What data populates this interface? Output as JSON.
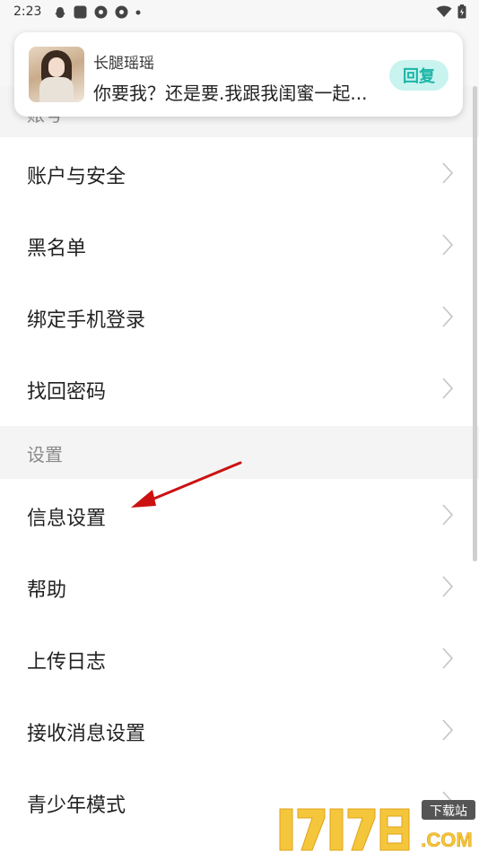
{
  "status_bar": {
    "time": "2:23"
  },
  "notification": {
    "sender": "长腿瑶瑶",
    "message": "你要我？还是要.我跟我闺蜜一起...",
    "reply_label": "回复"
  },
  "sections": [
    {
      "header": "账号",
      "items": [
        "账户与安全",
        "黑名单",
        "绑定手机登录",
        "找回密码"
      ]
    },
    {
      "header": "设置",
      "items": [
        "信息设置",
        "帮助",
        "上传日志",
        "接收消息设置",
        "青少年模式"
      ]
    }
  ],
  "watermark": {
    "brand": "17178",
    "domain": ".COM",
    "tag": "下载站"
  },
  "colors": {
    "accent": "#1bb5a7",
    "annotation_arrow": "#cc1111",
    "section_bg": "#f4f4f4"
  }
}
